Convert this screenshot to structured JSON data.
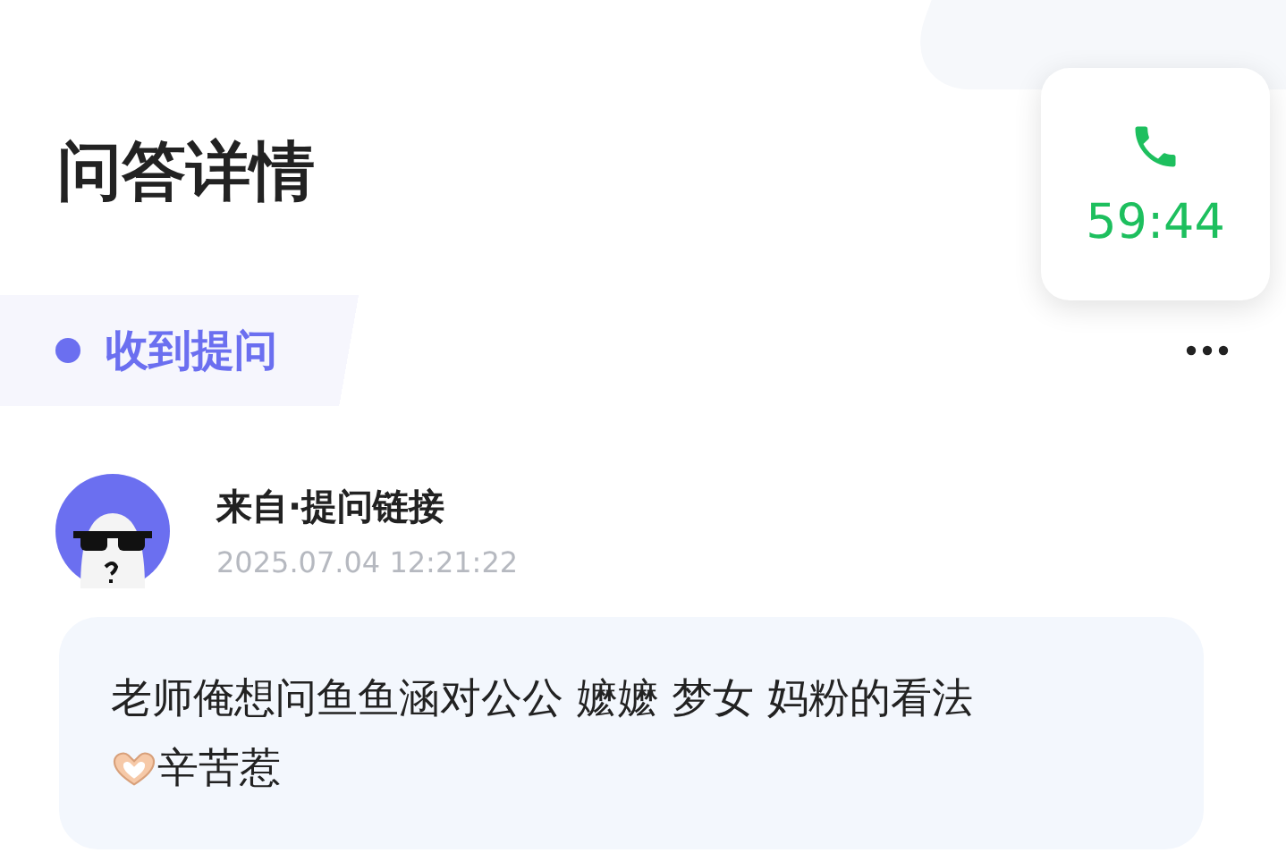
{
  "header": {
    "title": "问答详情"
  },
  "call": {
    "timer": "59:44"
  },
  "status": {
    "label": "收到提问",
    "color": "#6b6ff0"
  },
  "question": {
    "source": "来自·提问链接",
    "time": "2025.07.04 12:21:22",
    "lines": [
      "老师俺想问鱼鱼涵对公公 嬷嬷 梦女 妈粉的看法",
      "辛苦惹"
    ]
  }
}
